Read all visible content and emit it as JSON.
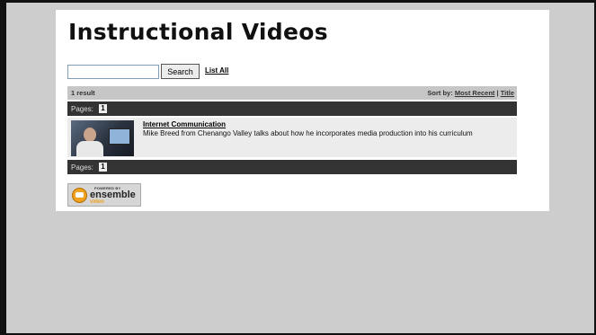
{
  "page": {
    "title": "Instructional Videos"
  },
  "search": {
    "value": "",
    "placeholder": "",
    "button_label": "Search",
    "list_all_label": "List All"
  },
  "results": {
    "count_label": "1 result",
    "sort_prefix": "Sort by:",
    "sort_options": [
      "Most Recent",
      "Title"
    ],
    "sort_separator": " | "
  },
  "pagination": {
    "label": "Pages:",
    "pages": [
      "1"
    ]
  },
  "videos": [
    {
      "title": "Internet Communication",
      "description": "Mike Breed from Chenango Valley talks about how he incorporates media production into his curriculum"
    }
  ],
  "badge": {
    "powered_by": "POWERED BY",
    "name": "ensemble",
    "sub": "video"
  },
  "colors": {
    "background": "#cdcdcd",
    "panel": "#ffffff",
    "results_bar": "#c6c6c6",
    "pages_bar": "#333333",
    "result_row": "#ececec",
    "badge_accent": "#f0a11f"
  }
}
